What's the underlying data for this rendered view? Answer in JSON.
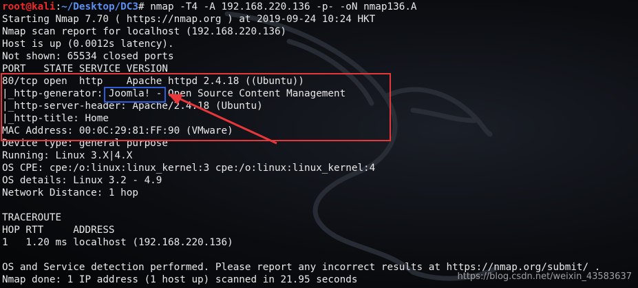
{
  "prompt": {
    "user_host": "root@kali",
    "colon": ":",
    "path": "~/Desktop/DC3",
    "symbol": "# ",
    "command": "nmap -T4 -A 192.168.220.136 -p- -oN nmap136.A"
  },
  "output": [
    "Starting Nmap 7.70 ( https://nmap.org ) at 2019-09-24 10:24 HKT",
    "Nmap scan report for localhost (192.168.220.136)",
    "Host is up (0.0012s latency).",
    "Not shown: 65534 closed ports",
    "PORT   STATE SERVICE VERSION",
    "80/tcp open  http    Apache httpd 2.4.18 ((Ubuntu))",
    "|_http-generator: Joomla! - Open Source Content Management",
    "|_http-server-header: Apache/2.4.18 (Ubuntu)",
    "|_http-title: Home",
    "MAC Address: 00:0C:29:81:FF:90 (VMware)",
    "Device type: general purpose",
    "Running: Linux 3.X|4.X",
    "OS CPE: cpe:/o:linux:linux_kernel:3 cpe:/o:linux:linux_kernel:4",
    "OS details: Linux 3.2 - 4.9",
    "Network Distance: 1 hop",
    "",
    "TRACEROUTE",
    "HOP RTT     ADDRESS",
    "1   1.20 ms localhost (192.168.220.136)",
    "",
    "OS and Service detection performed. Please report any incorrect results at https://nmap.org/submit/ .",
    "Nmap done: 1 IP address (1 host up) scanned in 21.95 seconds"
  ],
  "annotations": {
    "box_color": "#e8373b",
    "highlight_color": "#2f5bd6",
    "arrow_color": "#e8373b"
  },
  "watermark": "https://blog.csdn.net/weixin_43583637",
  "colors": {
    "text": "#e9e9e9",
    "prompt_user": "#ef2929",
    "prompt_path": "#5c8ff0",
    "background": "#0b0d11"
  }
}
